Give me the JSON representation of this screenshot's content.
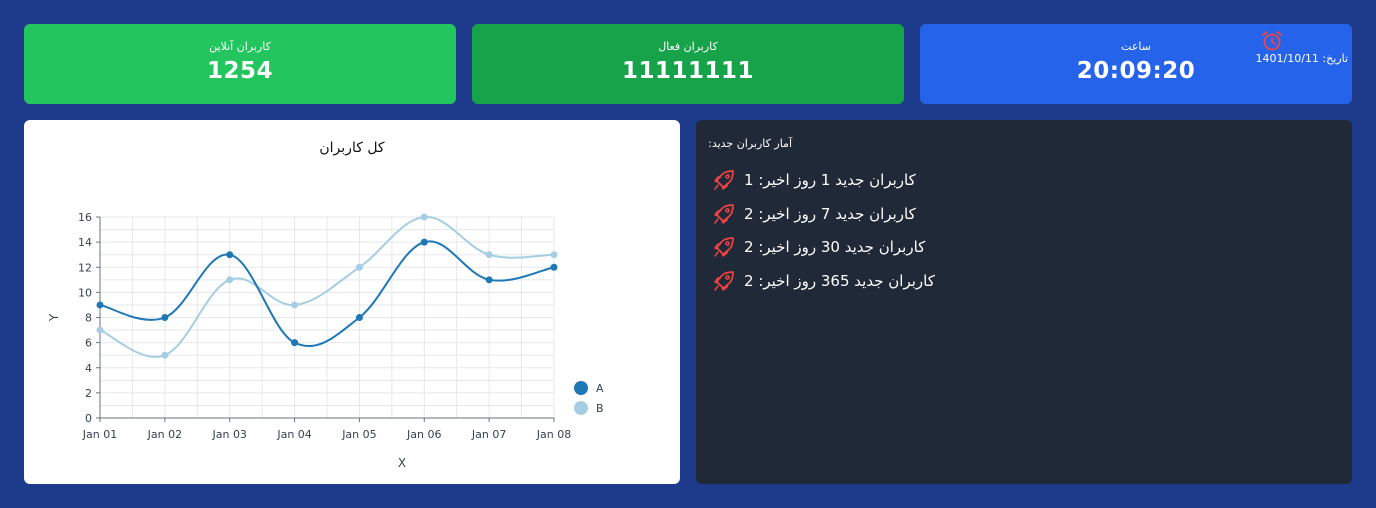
{
  "cards": {
    "online": {
      "label": "کاربران آنلاین",
      "value": "1254"
    },
    "active": {
      "label": "کاربران فعال",
      "value": "11111111"
    },
    "clock": {
      "label": "ساعت",
      "value": "20:09:20",
      "date_label": "تاریخ:",
      "date_value": "1401/10/11"
    }
  },
  "new_users": {
    "heading": "آمار کاربران جدید:",
    "items": [
      {
        "text": "کاربران جدید 1 روز اخیر: 1"
      },
      {
        "text": "کاربران جدید 7 روز اخیر: 2"
      },
      {
        "text": "کاربران جدید 30 روز اخیر: 2"
      },
      {
        "text": "کاربران جدید 365 روز اخیر: 2"
      }
    ]
  },
  "icons": {
    "alarm": "alarm-clock-icon",
    "rocket": "rocket-icon"
  },
  "colors": {
    "accent_red": "#ef4444",
    "series_a": "#1f77b4",
    "series_b": "#a6cee3"
  },
  "chart_data": {
    "type": "line",
    "title": "کل کاربران",
    "xlabel": "X",
    "ylabel": "Y",
    "categories": [
      "Jan 01",
      "Jan 02",
      "Jan 03",
      "Jan 04",
      "Jan 05",
      "Jan 06",
      "Jan 07",
      "Jan 08"
    ],
    "series": [
      {
        "name": "A",
        "values": [
          9,
          8,
          13,
          6,
          8,
          14,
          11,
          12
        ]
      },
      {
        "name": "B",
        "values": [
          7,
          5,
          11,
          9,
          12,
          16,
          13,
          13
        ]
      }
    ],
    "ylim": [
      0,
      16
    ],
    "yticks": [
      0,
      2,
      4,
      6,
      8,
      10,
      12,
      14,
      16
    ],
    "grid": true,
    "legend": "right",
    "smooth": true
  }
}
